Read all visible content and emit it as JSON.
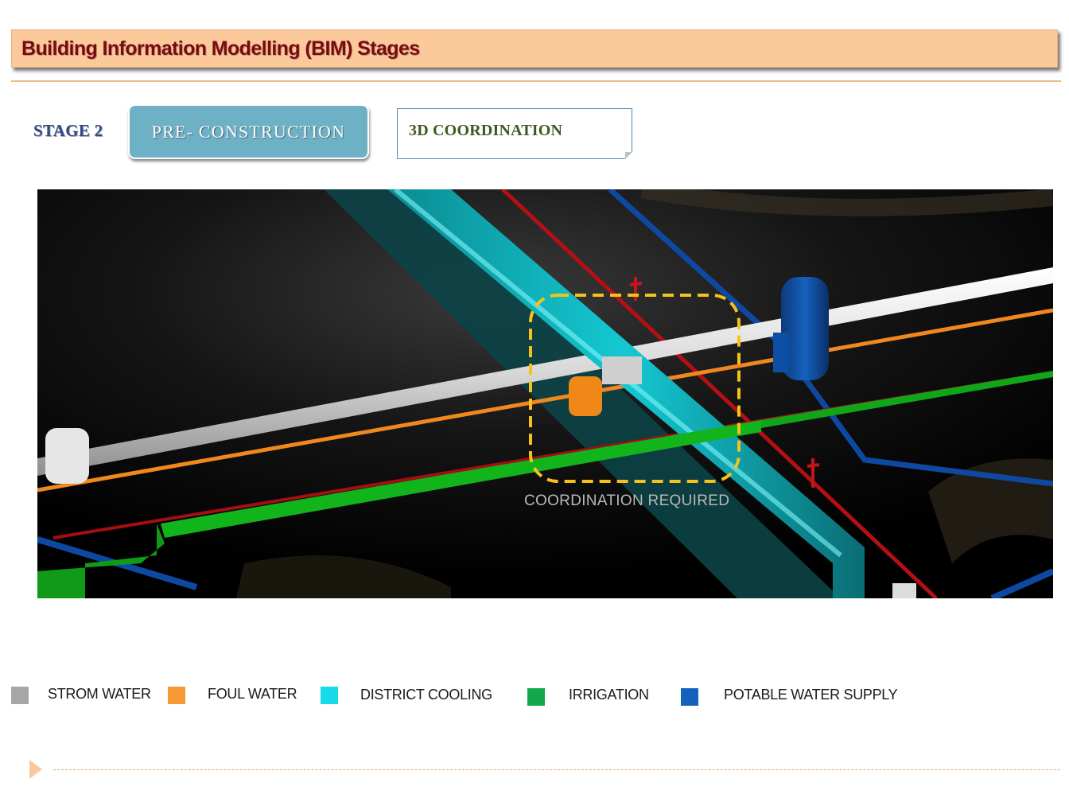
{
  "header": {
    "title": "Building Information Modelling (BIM) Stages"
  },
  "stage": {
    "label": "STAGE 2",
    "phase": "PRE- CONSTRUCTION",
    "topic": "3D COORDINATION"
  },
  "scene": {
    "callout": "COORDINATION REQUIRED",
    "callout_color": "#f4c21b"
  },
  "legend": [
    {
      "label": "STROM WATER",
      "color": "#a6a6a6"
    },
    {
      "label": "FOUL WATER",
      "color": "#f79a35"
    },
    {
      "label": "DISTRICT COOLING",
      "color": "#17dbe8"
    },
    {
      "label": "IRRIGATION",
      "color": "#13a84c"
    },
    {
      "label": "POTABLE WATER SUPPLY",
      "color": "#1363bd"
    }
  ]
}
